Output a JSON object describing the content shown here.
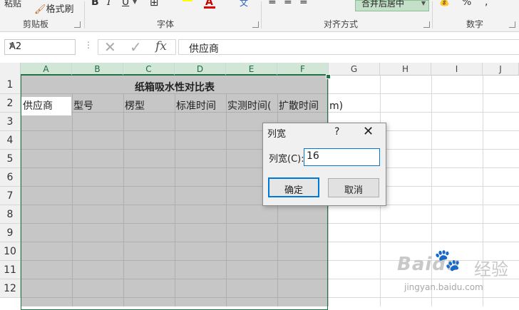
{
  "ribbon": {
    "clipboard": {
      "paste_label": "粘贴",
      "format_painter_label": "格式刷",
      "group_label": "剪贴板"
    },
    "font": {
      "bold": "B",
      "italic": "I",
      "underline": "U",
      "font_color_letter": "A",
      "wen_char": "文",
      "group_label": "字体"
    },
    "alignment": {
      "merge_label": "合并后居中",
      "group_label": "对齐方式"
    },
    "number": {
      "percent": "%",
      "group_label": "数字"
    }
  },
  "formula_bar": {
    "name_box": "A2",
    "cancel_symbol": "✕",
    "confirm_symbol": "✓",
    "fx_label": "fx",
    "content": "供应商"
  },
  "sheet": {
    "columns": [
      "A",
      "B",
      "C",
      "D",
      "E",
      "F",
      "G",
      "H",
      "I",
      "J"
    ],
    "rows": [
      "1",
      "2",
      "3",
      "4",
      "5",
      "6",
      "7",
      "8",
      "9",
      "10",
      "11",
      "12"
    ],
    "title": "纸箱吸水性对比表",
    "row2": [
      "供应商",
      "型号",
      "楞型",
      "标准时间",
      "实测时间(",
      "扩散时间"
    ],
    "overflow_text": "m)"
  },
  "dialog": {
    "title": "列宽",
    "help": "?",
    "close": "✕",
    "label": "列宽(C):",
    "value": "16",
    "ok": "确定",
    "cancel": "取消"
  },
  "watermark": {
    "brand": "Baidu",
    "cn": "经验",
    "url": "jingyan.baidu.com"
  },
  "colors": {
    "accent": "#217346",
    "selection": "#c6c6c6",
    "dialog_focus": "#0078d7"
  }
}
